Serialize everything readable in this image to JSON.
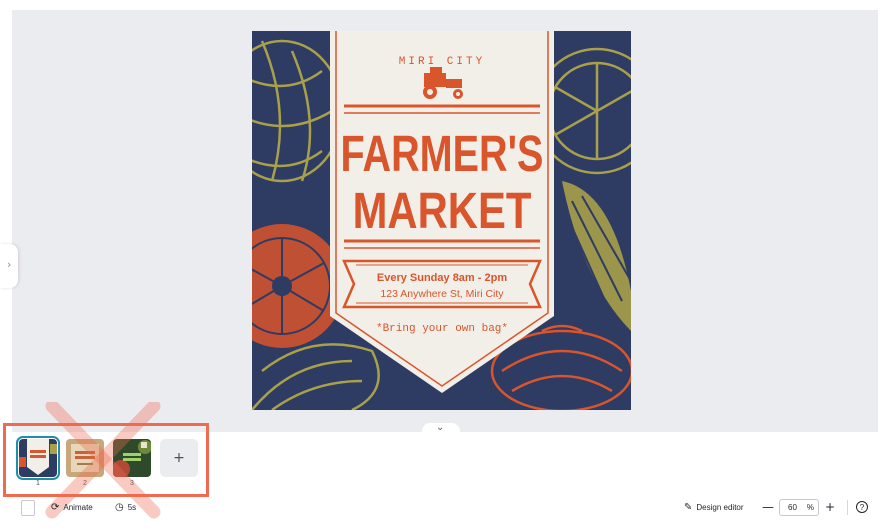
{
  "poster": {
    "city_arc": "MIRI CITY",
    "title_line1": "FARMER'S",
    "title_line2": "MARKET",
    "schedule": "Every Sunday 8am - 2pm",
    "address": "123 Anywhere St, Miri City",
    "tagline": "*Bring your own bag*",
    "colors": {
      "navy": "#2e3b62",
      "orange": "#d9552c",
      "olive": "#a8a04a",
      "cream": "#f2efe8"
    }
  },
  "pages": [
    {
      "number": "1",
      "selected": true,
      "thumb_title": "FARMER'S MARKET"
    },
    {
      "number": "2",
      "selected": false,
      "thumb_title": "FARMER'S MARKET"
    },
    {
      "number": "3",
      "selected": false,
      "thumb_title": "FARMERS MARKET"
    }
  ],
  "add_page_label": "+",
  "toolbar": {
    "animate_label": "Animate",
    "duration_label": "5s",
    "design_editor_label": "Design editor",
    "zoom_value": "60",
    "zoom_unit": "%",
    "zoom_minus": "—",
    "zoom_plus": "+",
    "help_label": "?"
  },
  "icons": {
    "collapse": "chevron-down-icon",
    "expand_panel": "chevron-right-icon",
    "animate": "animate-icon",
    "timer": "timer-icon",
    "design_editor": "pencil-icon"
  },
  "annotation": {
    "color": "#ee6b4f"
  }
}
